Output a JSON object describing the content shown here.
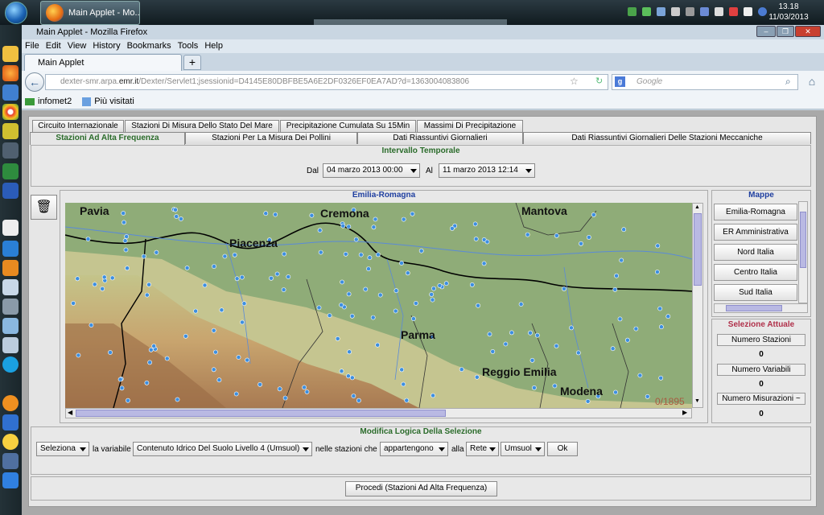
{
  "taskbar": {
    "button_label": "Main Applet - Mo...",
    "time": "13.18",
    "date": "11/03/2013"
  },
  "browser": {
    "window_title": "Main Applet - Mozilla Firefox",
    "menus": [
      "File",
      "Edit",
      "View",
      "History",
      "Bookmarks",
      "Tools",
      "Help"
    ],
    "tab_label": "Main Applet",
    "new_tab": "+",
    "url_prefix": "dexter-smr.arpa.",
    "url_host": "emr.it",
    "url_path": "/Dexter/Servlet1;jsessionid=D4145E80DBFBE5A6E2DF0326EF0EA7AD?d=1363004083806",
    "search_engine": "Google",
    "bookmarks": [
      "infomet2",
      "Più visitati"
    ]
  },
  "applet": {
    "tabs_row1": [
      "Circuito Internazionale",
      "Stazioni Di Misura Dello Stato Del Mare",
      "Precipitazione Cumulata Su 15Min",
      "Massimi Di Precipitazione"
    ],
    "tabs_row2": [
      "Stazioni Ad Alta Frequenza",
      "Stazioni Per La Misura Dei Pollini",
      "Dati Riassuntivi Giornalieri",
      "Dati Riassuntivi Giornalieri Delle Stazioni Meccaniche"
    ],
    "interval": {
      "title": "Intervallo Temporale",
      "from_label": "Dal",
      "from_value": "04 marzo 2013 00:00",
      "to_label": "Al",
      "to_value": "11 marzo 2013 12:14"
    },
    "map": {
      "title": "Emilia-Romagna",
      "cities": [
        "Pavia",
        "Cremona",
        "Mantova",
        "Piacenza",
        "Parma",
        "Reggio Emilia",
        "Modena"
      ],
      "counter": "0/1895"
    },
    "maps_panel": {
      "title": "Mappe",
      "items": [
        "Emilia-Romagna",
        "ER Amministrativa",
        "Nord Italia",
        "Centro Italia",
        "Sud Italia"
      ]
    },
    "selection": {
      "title": "Selezione Attuale",
      "stations_label": "Numero Stazioni",
      "stations_value": "0",
      "variables_label": "Numero Variabili",
      "variables_value": "0",
      "measures_label": "Numero Misurazioni ~",
      "measures_value": "0"
    },
    "logic": {
      "title": "Modifica Logica Della Selezione",
      "action": "Seleziona",
      "variable_label": "la variabile",
      "variable_value": "Contenuto Idrico Del Suolo Livello 4 (Umsuol)",
      "stations_label": "nelle stazioni che",
      "relation_value": "appartengono",
      "to_label": "alla",
      "network_value": "Rete",
      "network_name": "Umsuol",
      "ok": "Ok"
    },
    "proceed_button": "Procedi (Stazioni Ad Alta Frequenza)"
  },
  "colors": {
    "selected_tab_text": "#2a6b2a",
    "section_title": "#2a6b2a",
    "maps_title": "#1f3fa0",
    "selection_title": "#b0304a",
    "station_dot": "#3d8fe0"
  }
}
